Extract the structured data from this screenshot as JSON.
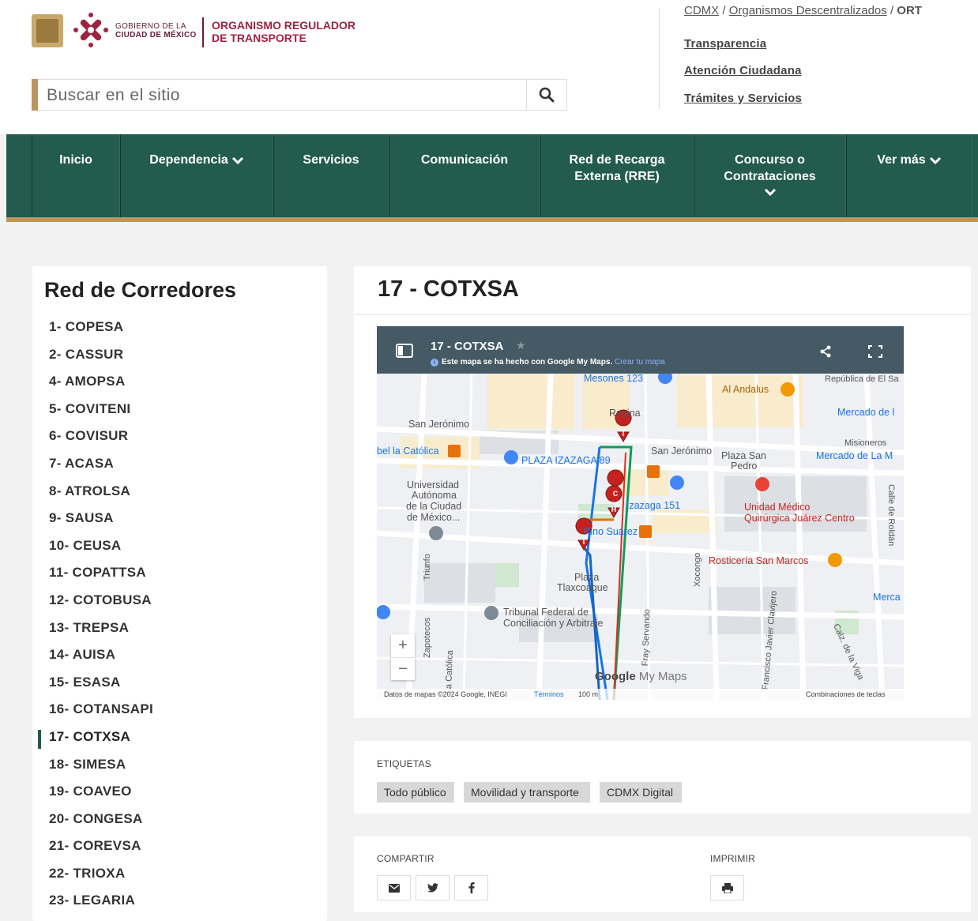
{
  "header": {
    "gov_line1": "GOBIERNO DE LA",
    "gov_line2": "CIUDAD DE MÉXICO",
    "org_line1": "ORGANISMO REGULADOR",
    "org_line2": "DE TRANSPORTE",
    "search_placeholder": "Buscar en el sitio",
    "breadcrumb": {
      "item1": "CDMX",
      "sep": "/",
      "item2": "Organismos Descentralizados",
      "current": "ORT"
    },
    "links": [
      "Transparencia",
      "Atención Ciudadana",
      "Trámites y Servicios"
    ]
  },
  "nav": {
    "items": [
      {
        "label": "Inicio"
      },
      {
        "label": "Dependencia"
      },
      {
        "label": "Servicios"
      },
      {
        "label": "Comunicación"
      },
      {
        "label_l1": "Red de Recarga",
        "label_l2": "Externa (RRE)"
      },
      {
        "label_l1": "Concurso o",
        "label_l2": "Contrataciones"
      },
      {
        "label": "Ver más"
      }
    ]
  },
  "sidebar": {
    "title": "Red de Corredores",
    "items": [
      "1- COPESA",
      "2- CASSUR",
      "4- AMOPSA",
      "5- COVITENI",
      "6- COVISUR",
      "7- ACASA",
      "8- ATROLSA",
      "9- SAUSA",
      "10- CEUSA",
      "11- COPATTSA",
      "12- COTOBUSA",
      "13- TREPSA",
      "14- AUISA",
      "15- ESASA",
      "16- COTANSAPI",
      "17- COTXSA",
      "18- SIMESA",
      "19- COAVEO",
      "20- CONGESA",
      "21- COREVSA",
      "22- TRIOXA",
      "23- LEGARIA"
    ],
    "active_index": 15
  },
  "main": {
    "title": "17 - COTXSA",
    "map": {
      "title": "17 - COTXSA",
      "subtitle": "Este mapa se ha hecho con Google My Maps.",
      "create_link": "Crear tu mapa",
      "labels": {
        "mesones": "Mesones 123",
        "al_andalus": "Al Andalus",
        "republica": "República de El Sa",
        "regina": "Regina",
        "mercado1": "Mercado de l",
        "san_jeronimo_w": "San Jerónimo",
        "misioneros": "Misioneros",
        "catolica": "bel la Católica",
        "plaza_izazaga": "PLAZA IZAZAGA 89",
        "san_jeronimo_e": "San Jerónimo",
        "plaza_san_pedro_1": "Plaza San",
        "plaza_san_pedro_2": "Pedro",
        "mercado2": "Mercado de La M",
        "universidad_1": "Universidad",
        "universidad_2": "Autónoma",
        "universidad_3": "de la Ciudad",
        "universidad_4": "de México...",
        "izazaga151": "Izazaga 151",
        "unidad_1": "Unidad Médico",
        "unidad_2": "Quirúrgica Juárez Centro",
        "pino_suarez": "Pino Suárez",
        "rosticeria": "Rosticería San Marcos",
        "plaza_tlax_1": "Plaza",
        "plaza_tlax_2": "Tlaxcoaque",
        "tribunal_1": "Tribunal Federal de",
        "tribunal_2": "Conciliación y Arbitraje",
        "merca": "Merca",
        "xocongo": "Xocongo",
        "clavijero": "Francisco Javier Clavijero",
        "calz_viga": "Calz. de la Viga",
        "fray": "Fray Servando",
        "zapotecos": "Zapotecos",
        "la_catolica": "La Católica",
        "triunfo": "Triunfo",
        "calle_roldan": "Calle de Roldán",
        "google": "Google",
        "my_maps": "My Maps"
      },
      "footer": {
        "data": "Datos de mapas ©2024 Google, INEGI",
        "terms": "Términos",
        "scale": "100 m",
        "shortcuts": "Combinaciones de teclas"
      },
      "zoom_in": "+",
      "zoom_out": "−"
    },
    "tags_label": "ETIQUETAS",
    "tags": [
      "Todo público",
      "Movilidad y transporte",
      "CDMX Digital"
    ],
    "share_label": "COMPARTIR",
    "print_label": "IMPRIMIR"
  },
  "colors": {
    "guinda": "#9f2241",
    "green": "#235b4e",
    "gold": "#bc955c"
  }
}
